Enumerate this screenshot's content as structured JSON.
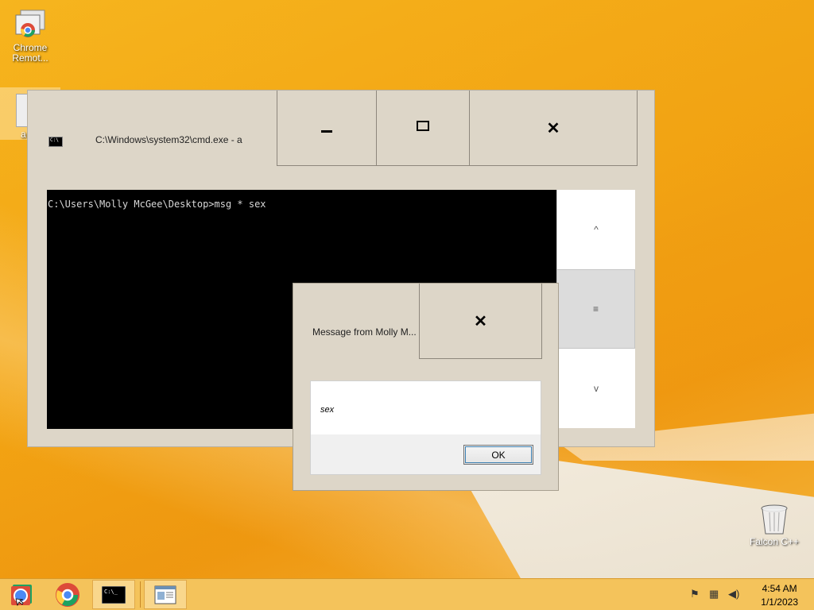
{
  "desktop": {
    "icons": [
      {
        "label": "Chrome Remot..."
      },
      {
        "label": "Falcon C++"
      }
    ],
    "partial_icon_label": "a"
  },
  "cmd_window": {
    "title": "C:\\Windows\\system32\\cmd.exe - a",
    "minimize_glyph": "–",
    "maximize_glyph": "□",
    "close_glyph": "✕",
    "console_text": "C:\\Users\\Molly McGee\\Desktop>msg * sex",
    "scroll_up_glyph": "^",
    "scroll_thumb_glyph": "≡",
    "scroll_down_glyph": "v"
  },
  "message_box": {
    "title": "Message from Molly M...",
    "close_glyph": "✕",
    "message": "sex",
    "ok_label": "OK"
  },
  "taskbar": {
    "items": [
      "remote-desktop-icon",
      "chrome-icon",
      "cmd-icon",
      "app-window-icon"
    ],
    "time": "4:54 AM",
    "date": "1/1/2023"
  },
  "colors": {
    "desktop": "#f5a915",
    "taskbar": "#f4c35b",
    "window_frame": "#ddd6c8",
    "console_bg": "#000000"
  }
}
